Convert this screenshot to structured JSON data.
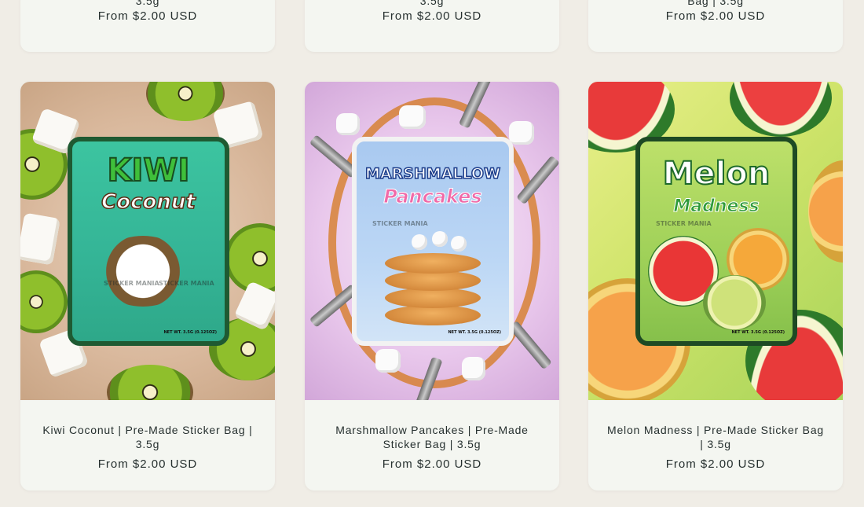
{
  "top_row": [
    {
      "title_tail": "3.5g",
      "price": "From $2.00 USD"
    },
    {
      "title_tail": "3.5g",
      "price": "From $2.00 USD"
    },
    {
      "title_tail": "Bag | 3.5g",
      "price": "From $2.00 USD"
    }
  ],
  "products": [
    {
      "title": "Kiwi Coconut | Pre-Made Sticker Bag | 3.5g",
      "price": "From $2.00 USD",
      "bag_text_1": "KIWI",
      "bag_text_2": "Coconut",
      "brand": "STICKER MANIA",
      "net_wt": "NET WT. 3.5G (0.125OZ)"
    },
    {
      "title": "Marshmallow Pancakes | Pre-Made Sticker Bag | 3.5g",
      "price": "From $2.00 USD",
      "bag_text_1": "MARSHMALLOW",
      "bag_text_2": "Pancakes",
      "brand": "STICKER MANIA",
      "net_wt": "NET WT. 3.5G (0.125OZ)"
    },
    {
      "title": "Melon Madness | Pre-Made Sticker Bag | 3.5g",
      "price": "From $2.00 USD",
      "bag_text_1": "Melon",
      "bag_text_2": "Madness",
      "brand": "STICKER MANIA",
      "net_wt": "NET WT. 3.5G (0.125OZ)"
    }
  ],
  "colors": {
    "page_background": "#f0ede6",
    "card_background": "#f4f6f1",
    "text": "#26302f"
  }
}
